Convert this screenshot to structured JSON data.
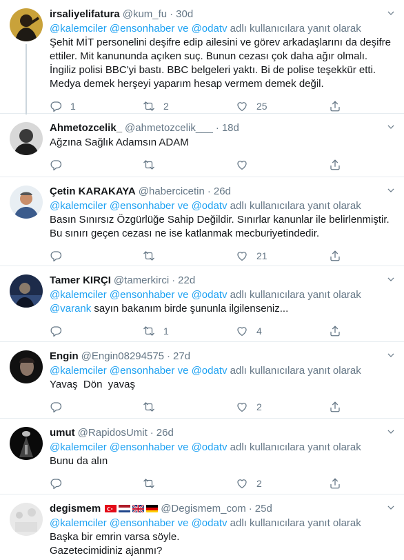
{
  "reply_prefix": "adlı kullanıcılara yanıt olarak",
  "tweets": [
    {
      "name": "irsaliyelifatura",
      "handle": "@kum_fu",
      "time": "30d",
      "mentions": [
        "@kalemciler",
        "@ensonhaber",
        "@odatv"
      ],
      "mention_joiner": "ve",
      "body": "Şehit MİT personelini deşifre edip ailesini ve görev arkadaşlarını da deşifre ettiler. Mit kanununda açıken suç. Bunun cezası çok daha ağır olmalı. İngiliz polisi BBC'yi bastı. BBC belgeleri yaktı. Bi de polise teşekkür etti. Medya demek herşeyi yaparım hesap vermem demek değil.",
      "replies": "1",
      "retweets": "2",
      "likes": "25"
    },
    {
      "name": "Ahmetozcelik_",
      "handle": "@ahmetozcelik___",
      "time": "18d",
      "body": "Ağzına Sağlık Adamsın ADAM",
      "replies": "",
      "retweets": "",
      "likes": ""
    },
    {
      "name": "Çetin KARAKAYA",
      "handle": "@habercicetin",
      "time": "26d",
      "body": "Basın Sınırsız Özgürlüğe Sahip Değildir. Sınırlar kanunlar ile belirlenmiştir. Bu sınırı geçen cezası ne ise katlanmak mecburiyetindedir.",
      "replies": "",
      "retweets": "",
      "likes": "21"
    },
    {
      "name": "Tamer KIRÇI",
      "handle": "@tamerkirci",
      "time": "22d",
      "body_mention": "@varank",
      "body": " sayın bakanım birde şununla ilgilenseniz...",
      "replies": "",
      "retweets": "1",
      "likes": "4"
    },
    {
      "name": "Engin",
      "handle": "@Engin08294575",
      "time": "27d",
      "body": "Yavaş  Dön  yavaş",
      "replies": "",
      "retweets": "",
      "likes": "2"
    },
    {
      "name": "umut",
      "handle": "@RapidosUmit",
      "time": "26d",
      "body": "Bunu da alın",
      "replies": "",
      "retweets": "",
      "likes": "2"
    },
    {
      "name": "degismem",
      "handle": "@Degismem_com",
      "time": "25d",
      "body": "Başka bir emrin varsa söyle.",
      "body2": "Gazetecimidiniz ajanmı?"
    }
  ],
  "icons": {
    "reply": "reply-icon",
    "retweet": "retweet-icon",
    "like": "heart-icon",
    "share": "share-icon",
    "caret": "chevron-down-icon"
  },
  "colors": {
    "link": "#1da1f2",
    "muted": "#657786",
    "divider": "#e6ecf0",
    "text": "#14171a"
  }
}
